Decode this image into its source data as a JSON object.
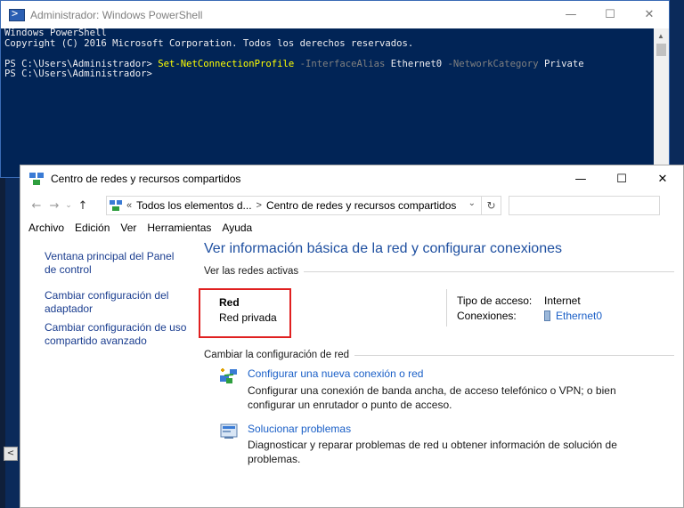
{
  "powershell": {
    "title": "Administrador: Windows PowerShell",
    "lines": {
      "l1": "Windows PowerShell",
      "l2": "Copyright (C) 2016 Microsoft Corporation. Todos los derechos reservados.",
      "prompt1": "PS C:\\Users\\Administrador> ",
      "cmd": "Set-NetConnectionProfile",
      "param1": " -InterfaceAlias",
      "arg1": " Ethernet0",
      "param2": " -NetworkCategory",
      "arg2": " Private",
      "prompt2": "PS C:\\Users\\Administrador>"
    }
  },
  "network_window": {
    "title": "Centro de redes y recursos compartidos",
    "address": {
      "chevrons": "«",
      "crumb1": "Todos los elementos d...",
      "separator": ">",
      "crumb2": "Centro de redes y recursos compartidos"
    },
    "menu": [
      "Archivo",
      "Edición",
      "Ver",
      "Herramientas",
      "Ayuda"
    ],
    "sidebar": [
      "Ventana principal del Panel de control",
      "Cambiar configuración del adaptador",
      "Cambiar configuración de uso compartido avanzado"
    ],
    "main_title": "Ver información básica de la red y configurar conexiones",
    "active_networks_header": "Ver las redes activas",
    "network": {
      "name": "Red",
      "type": "Red privada",
      "access_label": "Tipo de acceso:",
      "access_value": "Internet",
      "connections_label": "Conexiones:",
      "connections_value": "Ethernet0"
    },
    "change_header": "Cambiar la configuración de red",
    "tasks": [
      {
        "link": "Configurar una nueva conexión o red",
        "desc": "Configurar una conexión de banda ancha, de acceso telefónico o VPN; o bien configurar un enrutador o punto de acceso."
      },
      {
        "link": "Solucionar problemas",
        "desc": "Diagnosticar y reparar problemas de red u obtener información de solución de problemas."
      }
    ]
  },
  "icons": {
    "powershell": "powershell-icon",
    "network": "network-center-icon",
    "ethernet": "ethernet-icon",
    "new_connection": "new-connection-icon",
    "troubleshoot": "troubleshoot-icon"
  }
}
